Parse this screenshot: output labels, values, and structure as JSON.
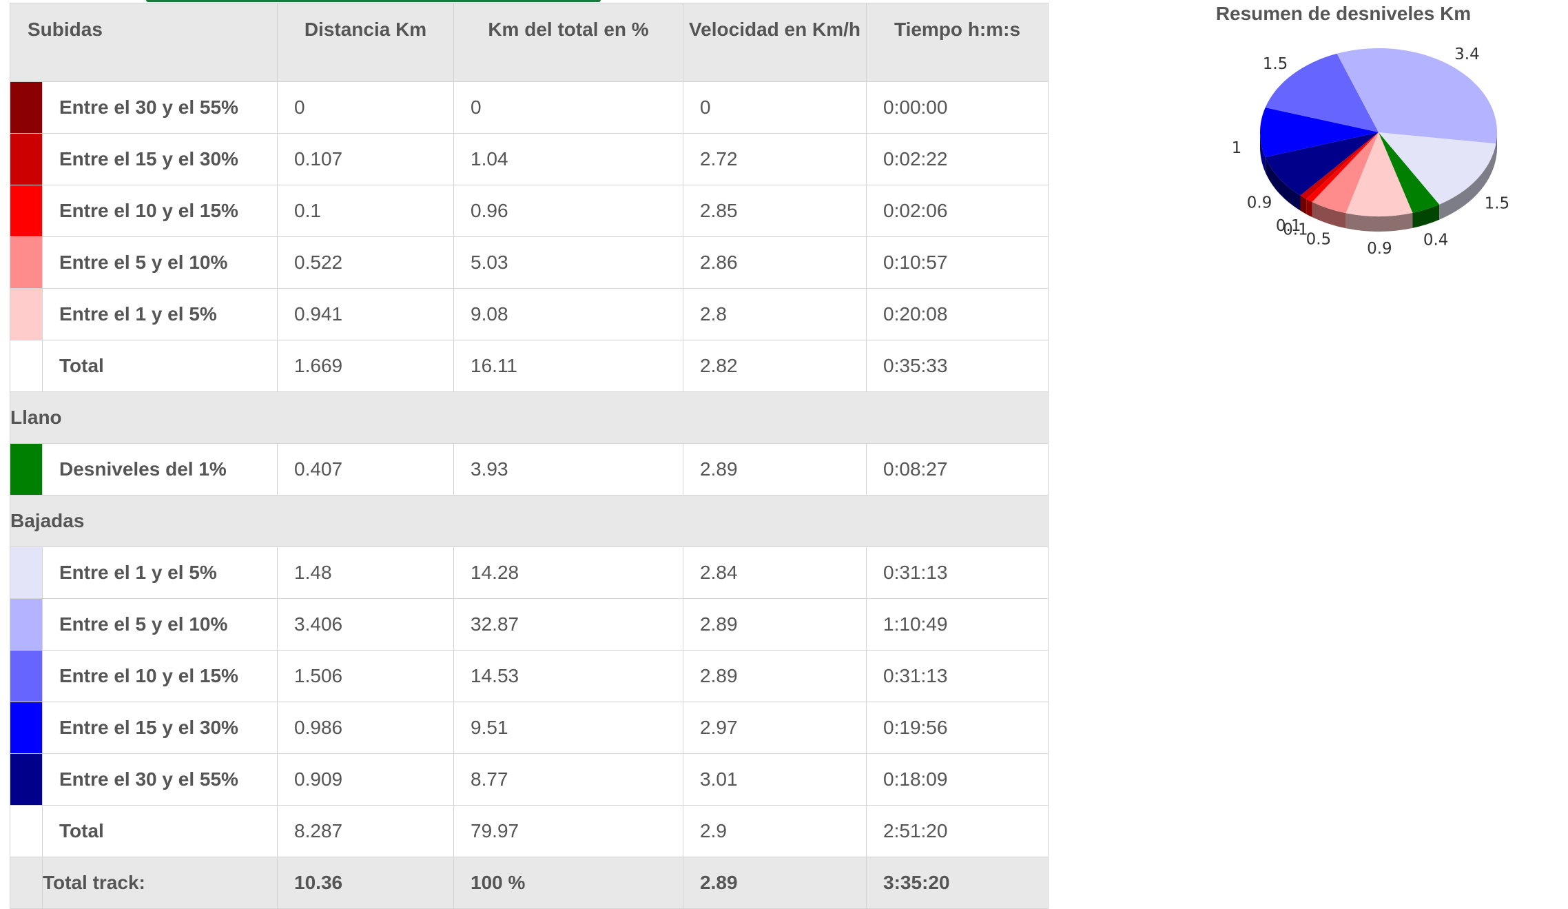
{
  "table": {
    "headers": {
      "subidas": "Subidas",
      "distancia": "Distancia Km",
      "porcentaje": "Km del total en %",
      "velocidad": "Velocidad en Km/h",
      "tiempo": "Tiempo h:m:s"
    },
    "subidas_rows": [
      {
        "color": "#8b0000",
        "label": "Entre el 30 y el 55%",
        "dist": "0",
        "pct": "0",
        "vel": "0",
        "time": "0:00:00"
      },
      {
        "color": "#cc0000",
        "label": "Entre el 15 y el 30%",
        "dist": "0.107",
        "pct": "1.04",
        "vel": "2.72",
        "time": "0:02:22"
      },
      {
        "color": "#ff0000",
        "label": "Entre el 10 y el 15%",
        "dist": "0.1",
        "pct": "0.96",
        "vel": "2.85",
        "time": "0:02:06"
      },
      {
        "color": "#ff8c8c",
        "label": "Entre el 5 y el 10%",
        "dist": "0.522",
        "pct": "5.03",
        "vel": "2.86",
        "time": "0:10:57"
      },
      {
        "color": "#ffcccc",
        "label": "Entre el 1 y el 5%",
        "dist": "0.941",
        "pct": "9.08",
        "vel": "2.8",
        "time": "0:20:08"
      },
      {
        "color": "#ffffff",
        "label": "Total",
        "dist": "1.669",
        "pct": "16.11",
        "vel": "2.82",
        "time": "0:35:33"
      }
    ],
    "llano_title": "Llano",
    "llano_rows": [
      {
        "color": "#008000",
        "label": "Desniveles del 1%",
        "dist": "0.407",
        "pct": "3.93",
        "vel": "2.89",
        "time": "0:08:27"
      }
    ],
    "bajadas_title": "Bajadas",
    "bajadas_rows": [
      {
        "color": "#e4e4f8",
        "label": "Entre el 1 y el 5%",
        "dist": "1.48",
        "pct": "14.28",
        "vel": "2.84",
        "time": "0:31:13"
      },
      {
        "color": "#b3b3ff",
        "label": "Entre el 5 y el 10%",
        "dist": "3.406",
        "pct": "32.87",
        "vel": "2.89",
        "time": "1:10:49"
      },
      {
        "color": "#6666ff",
        "label": "Entre el 10 y el 15%",
        "dist": "1.506",
        "pct": "14.53",
        "vel": "2.89",
        "time": "0:31:13"
      },
      {
        "color": "#0000ff",
        "label": "Entre el 15 y el 30%",
        "dist": "0.986",
        "pct": "9.51",
        "vel": "2.97",
        "time": "0:19:56"
      },
      {
        "color": "#00008b",
        "label": "Entre el 30 y el 55%",
        "dist": "0.909",
        "pct": "8.77",
        "vel": "3.01",
        "time": "0:18:09"
      },
      {
        "color": "#ffffff",
        "label": "Total",
        "dist": "8.287",
        "pct": "79.97",
        "vel": "2.9",
        "time": "2:51:20"
      }
    ],
    "total_track": {
      "label": "Total track:",
      "dist": "10.36",
      "pct": "100 %",
      "vel": "2.89",
      "time": "3:35:20"
    }
  },
  "chart_data": {
    "type": "pie",
    "title": "Resumen de desniveles Km",
    "style": "3d",
    "slices": [
      {
        "label": "1.5",
        "value": 1.506,
        "color": "#6666ff"
      },
      {
        "label": "1",
        "value": 0.986,
        "color": "#0000ff"
      },
      {
        "label": "0.9",
        "value": 0.909,
        "color": "#00008b"
      },
      {
        "label": "0.1",
        "value": 0.107,
        "color": "#cc0000"
      },
      {
        "label": "0.1",
        "value": 0.1,
        "color": "#ff0000"
      },
      {
        "label": "0.5",
        "value": 0.522,
        "color": "#ff8c8c"
      },
      {
        "label": "0.9",
        "value": 0.941,
        "color": "#ffcccc"
      },
      {
        "label": "0.4",
        "value": 0.407,
        "color": "#008000"
      },
      {
        "label": "1.5",
        "value": 1.48,
        "color": "#e4e4f8"
      },
      {
        "label": "3.4",
        "value": 3.406,
        "color": "#b3b3ff"
      }
    ]
  }
}
